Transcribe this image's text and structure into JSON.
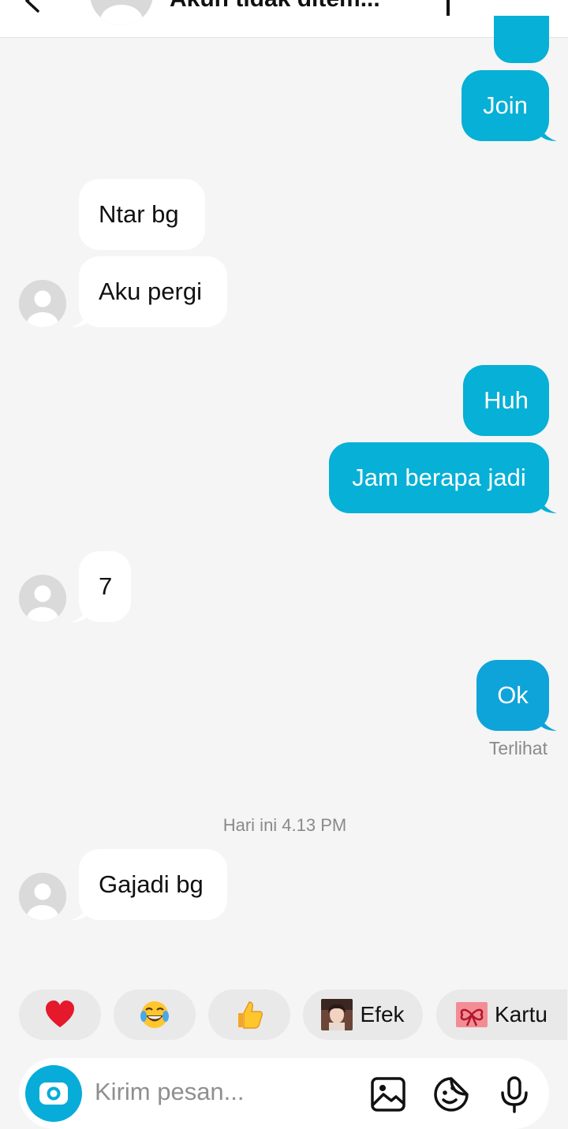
{
  "header": {
    "title": "Akun tidak ditem..."
  },
  "messages": {
    "join": "Join",
    "ntar": "Ntar bg",
    "aku_pergi": "Aku pergi",
    "huh": "Huh",
    "jam": "Jam berapa jadi",
    "seven": "7",
    "ok": "Ok",
    "seen_label": "Terlihat",
    "timestamp": "Hari ini 4.13 PM",
    "gajadi": "Gajadi bg"
  },
  "reactions": {
    "heart": "heart-emoji",
    "laugh": "face-with-tears-of-joy-emoji",
    "thumbs": "thumbs-up-emoji",
    "effects_label": "Efek",
    "card_label": "Kartu"
  },
  "composer": {
    "placeholder": "Kirim pesan..."
  },
  "colors": {
    "outgoing_bubble": "#06b0d6",
    "incoming_bubble": "#ffffff",
    "background": "#f5f5f5",
    "accent": "#08acd8"
  }
}
